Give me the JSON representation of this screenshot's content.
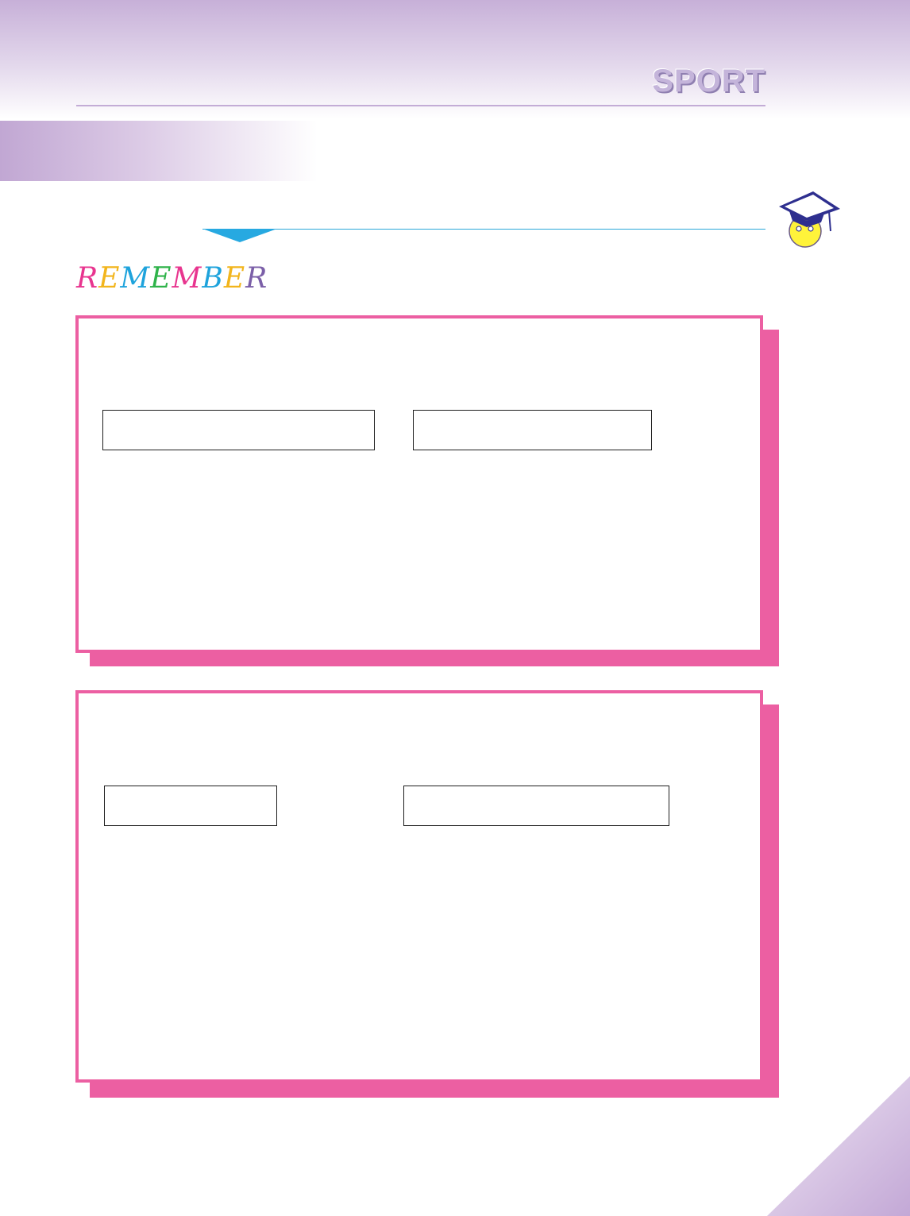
{
  "header": {
    "title": "SPORT",
    "band_color": "#c7b0d8",
    "rule_color": "#c3acd6"
  },
  "accent": {
    "pointer_color": "#27a9e1",
    "card_border_color": "#ec5fa2"
  },
  "remember": {
    "letters": [
      {
        "char": "R",
        "color": "#e8358f"
      },
      {
        "char": "E",
        "color": "#f2b51c"
      },
      {
        "char": "M",
        "color": "#1ea3dc"
      },
      {
        "char": "E",
        "color": "#2fb34a"
      },
      {
        "char": "M",
        "color": "#e8358f"
      },
      {
        "char": "B",
        "color": "#1ea3dc"
      },
      {
        "char": "E",
        "color": "#f2b51c"
      },
      {
        "char": "R",
        "color": "#7b5fa8"
      }
    ]
  },
  "mascot": {
    "icon": "graduate-smiley-icon"
  },
  "cards": [
    {
      "fields": [
        {
          "value": "",
          "placeholder": ""
        },
        {
          "value": "",
          "placeholder": ""
        }
      ]
    },
    {
      "fields": [
        {
          "value": "",
          "placeholder": ""
        },
        {
          "value": "",
          "placeholder": ""
        }
      ]
    }
  ]
}
